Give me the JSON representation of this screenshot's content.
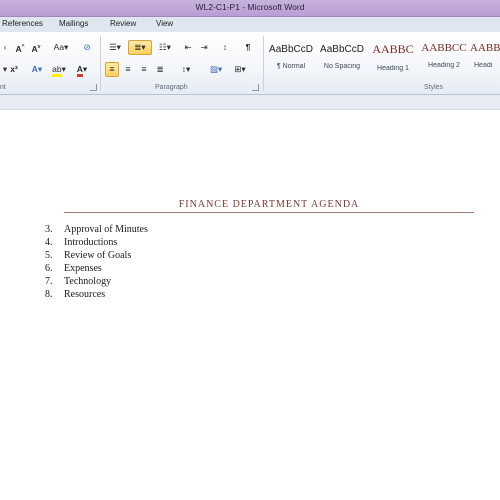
{
  "window": {
    "title": "WL2-C1-P1 - Microsoft Word"
  },
  "ribbon_tabs": [
    "References",
    "Mailings",
    "Review",
    "View"
  ],
  "ribbon": {
    "font_group": {
      "label": "nt",
      "row1": [
        "A˄",
        "A˅",
        "Aa",
        "⌀"
      ],
      "row2": [
        "x²",
        "A",
        "ab⁄",
        "A"
      ]
    },
    "paragraph_group": {
      "label": "Paragraph"
    },
    "styles_group": {
      "label": "Styles",
      "styles": [
        {
          "sample": "AaBbCcD",
          "name": "¶ Normal",
          "kind": "normal"
        },
        {
          "sample": "AaBbCcD",
          "name": "No Spacing",
          "kind": "normal"
        },
        {
          "sample": "AABBC",
          "name": "Heading 1",
          "kind": "heading"
        },
        {
          "sample": "AABBCC",
          "name": "Heading 2",
          "kind": "heading"
        },
        {
          "sample": "AABB",
          "name": "Headi",
          "kind": "heading"
        }
      ]
    }
  },
  "document": {
    "title": "FINANCE DEPARTMENT AGENDA",
    "items": [
      {
        "num": "3.",
        "text": "Approval of Minutes"
      },
      {
        "num": "4.",
        "text": "Introductions"
      },
      {
        "num": "5.",
        "text": "Review of Goals"
      },
      {
        "num": "6.",
        "text": "Expenses"
      },
      {
        "num": "7.",
        "text": "Technology"
      },
      {
        "num": "8.",
        "text": "Resources"
      }
    ]
  },
  "colors": {
    "title_bar": "#b89ed4",
    "heading_text": "#7b3a2f",
    "selected_button": "#ffd15c"
  }
}
